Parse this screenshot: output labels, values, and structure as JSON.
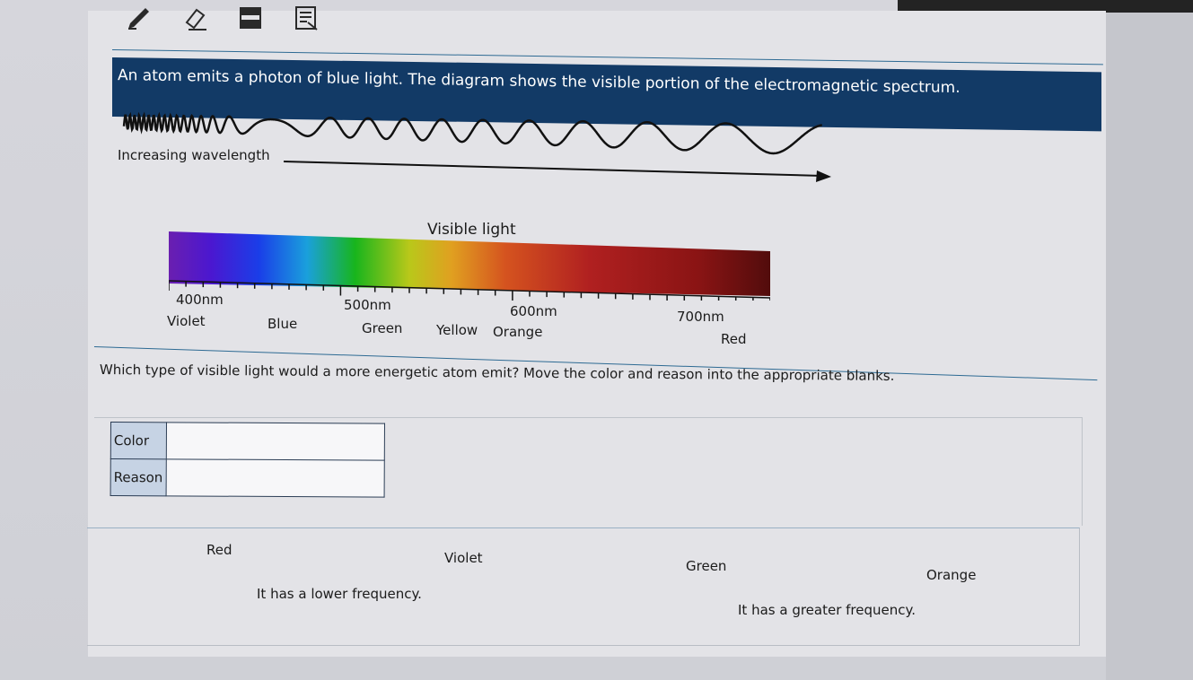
{
  "toolbar": {
    "icons": [
      "pencil-icon",
      "eraser-icon",
      "line-reader-icon",
      "notepad-icon"
    ]
  },
  "prompt": "An atom emits a photon of blue light. The diagram shows the visible portion of the electromagnetic spectrum.",
  "wave_diagram": {
    "label": "Increasing wavelength"
  },
  "spectrum": {
    "title": "Visible light",
    "tick_labels": [
      "400nm",
      "500nm",
      "600nm",
      "700nm"
    ],
    "colors": [
      "Violet",
      "Blue",
      "Green",
      "Yellow",
      "Orange",
      "Red"
    ]
  },
  "question": "Which type of visible light would a more energetic atom emit? Move the color and reason into the appropriate blanks.",
  "answer_table": {
    "rows": [
      {
        "label": "Color",
        "value": ""
      },
      {
        "label": "Reason",
        "value": ""
      }
    ]
  },
  "choices": {
    "colors": [
      "Red",
      "Violet",
      "Green",
      "Orange"
    ],
    "reasons": [
      "It has a lower frequency.",
      "It has a greater frequency."
    ]
  }
}
